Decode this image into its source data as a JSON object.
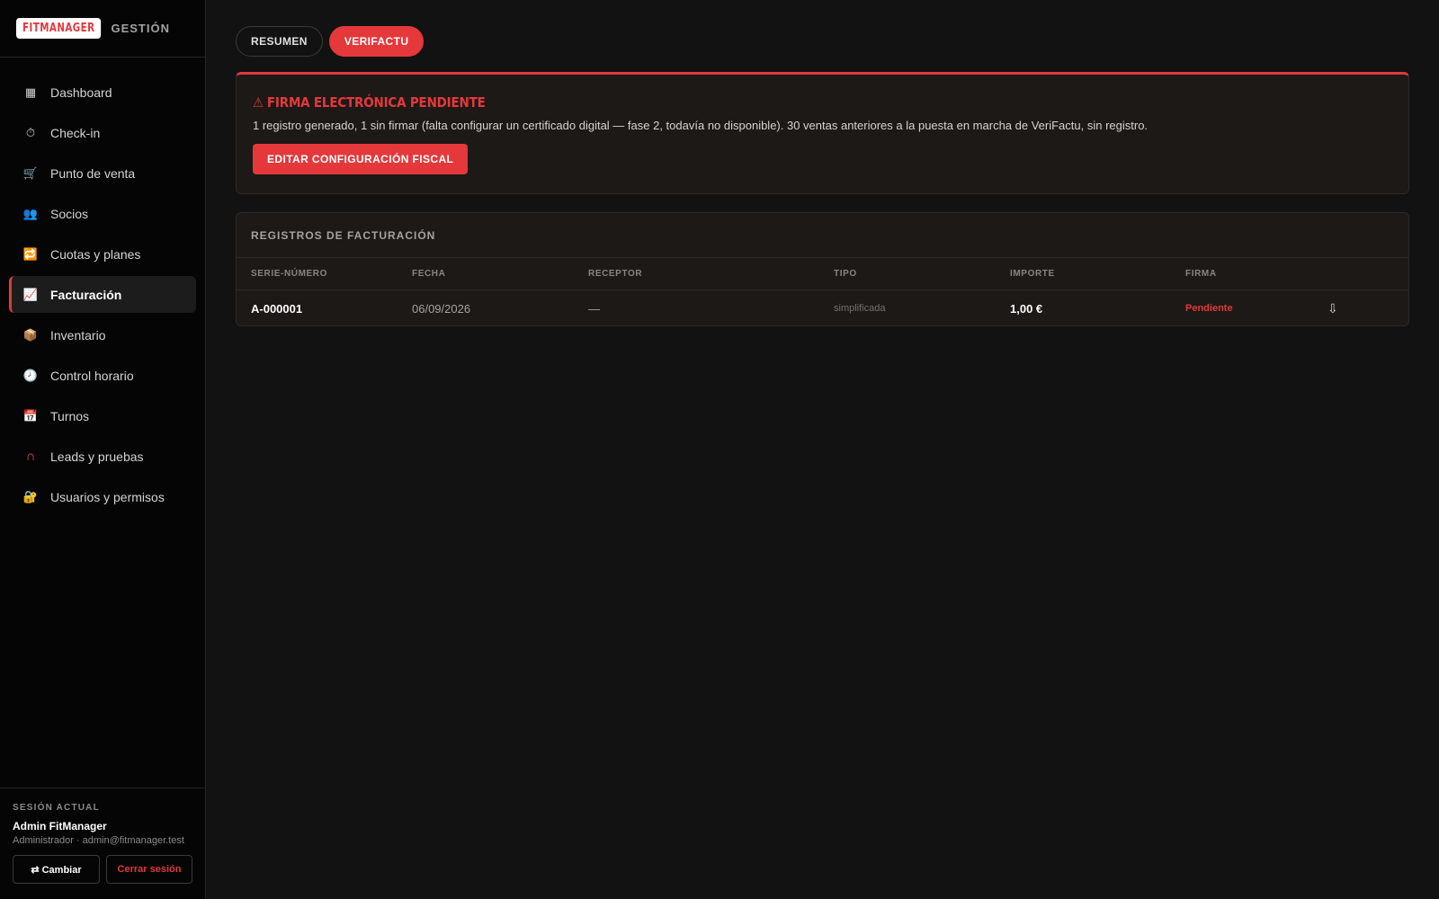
{
  "brand": {
    "logo": "FITMANAGER",
    "subtitle": "GESTIÓN"
  },
  "sidebar": {
    "items": [
      {
        "label": "Dashboard",
        "icon": "dashboard-icon",
        "glyph": "▦",
        "color": "#d4d4d4"
      },
      {
        "label": "Check-in",
        "icon": "stopwatch-icon",
        "glyph": "⏱",
        "color": "#d4d4d4"
      },
      {
        "label": "Punto de venta",
        "icon": "cart-icon",
        "glyph": "🛒",
        "color": "#d4d4d4"
      },
      {
        "label": "Socios",
        "icon": "people-icon",
        "glyph": "👥",
        "color": "#7c6fd6"
      },
      {
        "label": "Cuotas y planes",
        "icon": "repeat-icon",
        "glyph": "🔁",
        "color": "#3b82f6"
      },
      {
        "label": "Facturación",
        "icon": "chart-icon",
        "glyph": "📈",
        "color": "#93c5fd"
      },
      {
        "label": "Inventario",
        "icon": "package-icon",
        "glyph": "📦",
        "color": "#c08a4a"
      },
      {
        "label": "Control horario",
        "icon": "clock-icon",
        "glyph": "🕗",
        "color": "#d4d4d4"
      },
      {
        "label": "Turnos",
        "icon": "calendar-icon",
        "glyph": "📅",
        "color": "#3b82f6"
      },
      {
        "label": "Leads y pruebas",
        "icon": "magnet-icon",
        "glyph": "∩",
        "color": "#ef4466"
      },
      {
        "label": "Usuarios y permisos",
        "icon": "lock-icon",
        "glyph": "🔐",
        "color": "#eab308"
      }
    ],
    "active_index": 5
  },
  "session": {
    "label": "SESIÓN ACTUAL",
    "name": "Admin FitManager",
    "role": "Administrador · admin@fitmanager.test",
    "switch_label": "⇄ Cambiar",
    "logout_label": "Cerrar sesión"
  },
  "tabs": [
    {
      "label": "RESUMEN",
      "active": false
    },
    {
      "label": "VERIFACTU",
      "active": true
    }
  ],
  "alert": {
    "icon": "warning-icon",
    "glyph": "⚠",
    "title": "FIRMA ELECTRÓNICA PENDIENTE",
    "text": "1 registro generado, 1 sin firmar (falta configurar un certificado digital — fase 2, todavía no disponible). 30 ventas anteriores a la puesta en marcha de VeriFactu, sin registro.",
    "button_label": "EDITAR CONFIGURACIÓN FISCAL"
  },
  "records": {
    "title": "REGISTROS DE FACTURACIÓN",
    "columns": [
      "SERIE-NÚMERO",
      "FECHA",
      "RECEPTOR",
      "TIPO",
      "IMPORTE",
      "FIRMA"
    ],
    "rows": [
      {
        "serie": "A-000001",
        "fecha": "06/09/2026",
        "receptor": "—",
        "tipo": "simplificada",
        "importe": "1,00 €",
        "firma": "Pendiente",
        "download_glyph": "⇩"
      }
    ]
  },
  "colors": {
    "accent": "#e5383b",
    "background": "#121212",
    "sidebar": "#050505",
    "card": "#1c1917"
  }
}
